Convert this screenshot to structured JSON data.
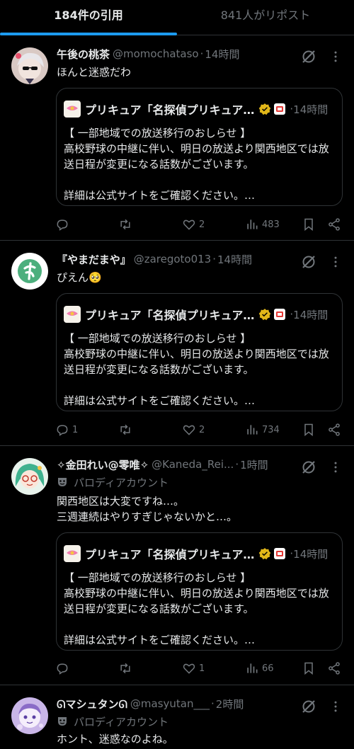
{
  "tabs": [
    {
      "label": "184件の引用",
      "active": true
    },
    {
      "label": "841人がリポスト",
      "active": false
    }
  ],
  "quoted_post": {
    "name": "プリキュア「名探偵プリキュア…",
    "time": "14時間",
    "body": "【 一部地域での放送移行のおしらせ 】\n高校野球の中継に伴い、明日の放送より関西地区では放送日程が変更になる話数がございます。\n\n詳細は公式サイトをご確認ください。…"
  },
  "tweets": [
    {
      "name": "午後の桃茶",
      "handle": "@momochataso",
      "time": "14時間",
      "text": "ほんと迷惑だわ",
      "replies": "",
      "reposts": "",
      "likes": "2",
      "views": "483",
      "avatar_icon": "anime-avatar-icon"
    },
    {
      "name": "『やまだまや』",
      "handle": "@zaregoto013",
      "time": "14時間",
      "text": "ぴえん🥺",
      "replies": "1",
      "reposts": "",
      "likes": "2",
      "views": "734",
      "avatar_icon": "ya-letter-avatar-icon"
    },
    {
      "name": "✧金田れい@零唯✧",
      "handle": "@Kaneda_Rei...",
      "time": "1時間",
      "parody": "パロディアカウント",
      "text": "関西地区は大変ですね…。\n三週連続はやりすぎじゃないかと…。",
      "replies": "",
      "reposts": "",
      "likes": "1",
      "views": "66",
      "avatar_icon": "anime-avatar-icon"
    },
    {
      "name": "ᘏマシュタンᘏ",
      "handle": "@masyutan___",
      "time": "2時間",
      "parody": "パロディアカウント",
      "text": "ホント、迷惑なのよね。",
      "avatar_icon": "anime-avatar-icon"
    }
  ],
  "colors": {
    "accent": "#1d9bf0",
    "verified": "#e2b719",
    "muted": "#71767b",
    "border": "#2f3336"
  }
}
